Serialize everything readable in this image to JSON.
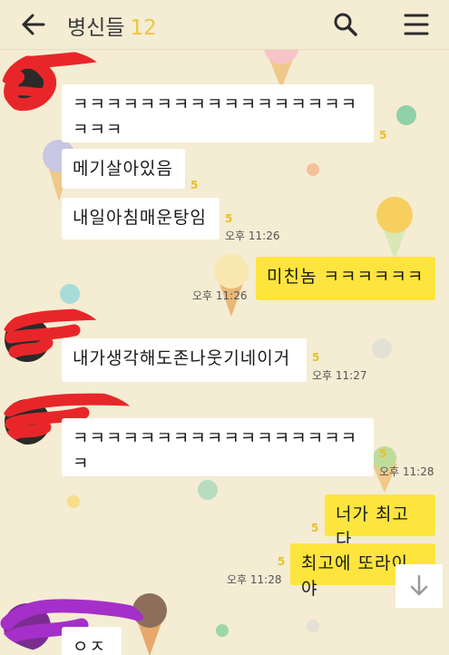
{
  "header": {
    "title": "병신들",
    "member_count": "12",
    "back_icon": "arrow-left-icon",
    "search_icon": "search-icon",
    "menu_icon": "hamburger-menu-icon"
  },
  "messages": [
    {
      "sender": "other",
      "lines": [
        "ㅋㅋㅋㅋㅋㅋㅋㅋㅋㅋㅋㅋㅋㅋㅋㅋㅋ",
        "ㅋㅋㅋ"
      ],
      "unread": "5",
      "time": ""
    },
    {
      "sender": "other",
      "lines": [
        "메기살아있음"
      ],
      "unread": "5",
      "time": ""
    },
    {
      "sender": "other",
      "lines": [
        "내일아침매운탕임"
      ],
      "unread": "5",
      "time": "오후 11:26"
    },
    {
      "sender": "me",
      "lines": [
        "미친놈 ㅋㅋㅋㅋㅋㅋ"
      ],
      "unread": "",
      "time": "오후 11:26"
    },
    {
      "sender": "other",
      "lines": [
        "내가생각해도존나웃기네이거"
      ],
      "unread": "5",
      "time": "오후 11:27"
    },
    {
      "sender": "other",
      "lines": [
        "ㅋㅋㅋㅋㅋㅋㅋㅋㅋㅋㅋㅋㅋㅋㅋㅋㅋ",
        "ㅋ"
      ],
      "unread": "5",
      "time": "오후 11:28"
    },
    {
      "sender": "me",
      "lines": [
        "너가 최고다"
      ],
      "unread": "5",
      "time": ""
    },
    {
      "sender": "me",
      "lines": [
        "최고에 또라이야"
      ],
      "unread": "5",
      "time": "오후 11:28"
    },
    {
      "sender": "other",
      "lines": [
        "ㅇㅈ"
      ],
      "unread": "",
      "time": ""
    }
  ],
  "scroll_down_icon": "arrow-down-icon",
  "colors": {
    "background": "#f4ecd3",
    "my_bubble": "#fde53e",
    "other_bubble": "#ffffff",
    "unread_count": "#e6c12a",
    "scribble_red": "#e8262a",
    "scribble_purple": "#a52fc9"
  }
}
